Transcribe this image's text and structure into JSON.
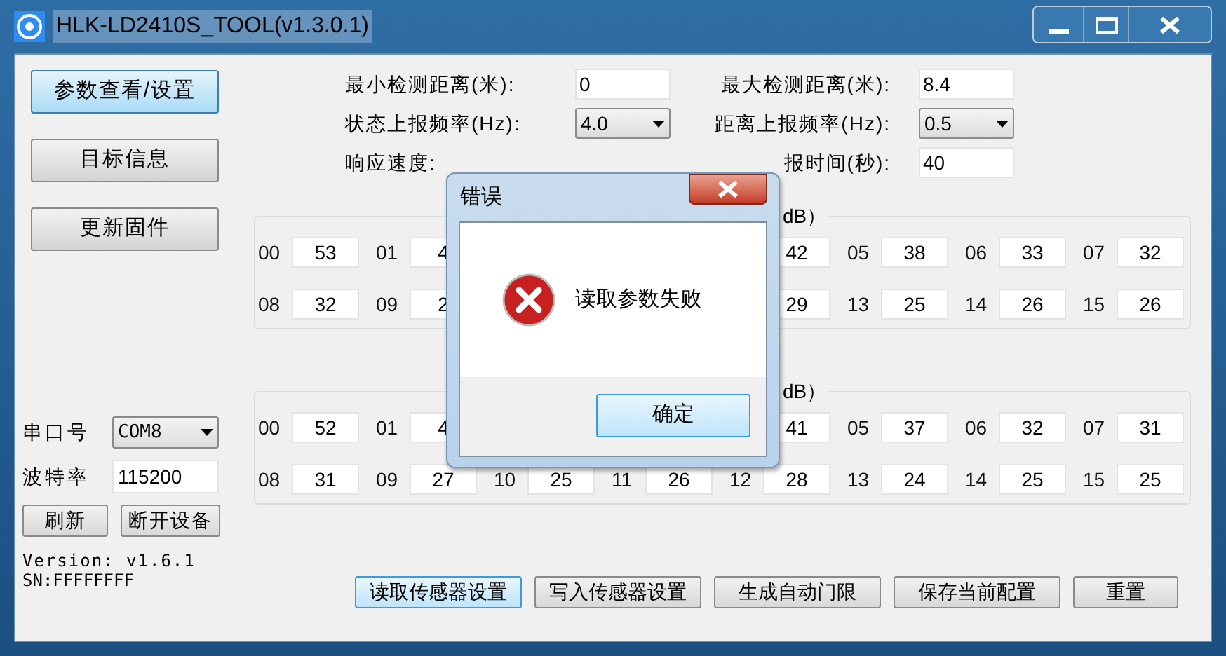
{
  "window": {
    "title": "HLK-LD2410S_TOOL(v1.3.0.1)"
  },
  "nav": [
    {
      "label": "参数查看/设置",
      "selected": true
    },
    {
      "label": "目标信息",
      "selected": false
    },
    {
      "label": "更新固件",
      "selected": false
    }
  ],
  "params_left": [
    {
      "label": "最小检测距离(米):",
      "kind": "field",
      "value": "0"
    },
    {
      "label": "状态上报频率(Hz):",
      "kind": "select",
      "value": "4.0"
    },
    {
      "label": "响应速度:",
      "kind": "none"
    }
  ],
  "params_right": [
    {
      "label": "最大检测距离(米):",
      "kind": "field",
      "value": "8.4"
    },
    {
      "label": "距离上报频率(Hz):",
      "kind": "select",
      "value": "0.5"
    },
    {
      "label": "报时间(秒):",
      "kind": "field",
      "value": "40"
    }
  ],
  "groups": [
    {
      "title": "dB）",
      "rows": [
        {
          "left": [
            {
              "gate": "00",
              "value": "53"
            },
            {
              "gate": "01",
              "value": "4"
            }
          ],
          "right": [
            {
              "value": "42"
            },
            {
              "gate": "05",
              "value": "38"
            },
            {
              "gate": "06",
              "value": "33"
            },
            {
              "gate": "07",
              "value": "32"
            }
          ]
        },
        {
          "left": [
            {
              "gate": "08",
              "value": "32"
            },
            {
              "gate": "09",
              "value": "2"
            }
          ],
          "right": [
            {
              "value": "29"
            },
            {
              "gate": "13",
              "value": "25"
            },
            {
              "gate": "14",
              "value": "26"
            },
            {
              "gate": "15",
              "value": "26"
            }
          ]
        }
      ]
    },
    {
      "title": "dB）",
      "rows": [
        {
          "left": [
            {
              "gate": "00",
              "value": "52"
            },
            {
              "gate": "01",
              "value": "4"
            }
          ],
          "right": [
            {
              "value": "41"
            },
            {
              "gate": "05",
              "value": "37"
            },
            {
              "gate": "06",
              "value": "32"
            },
            {
              "gate": "07",
              "value": "31"
            }
          ]
        },
        {
          "left": [
            {
              "gate": "08",
              "value": "31"
            },
            {
              "gate": "09",
              "value": "27"
            },
            {
              "gate": "10",
              "value": "25"
            },
            {
              "gate": "11",
              "value": "26"
            },
            {
              "gate": "12",
              "value": "28"
            },
            {
              "gate": "13",
              "value": "24"
            },
            {
              "gate": "14",
              "value": "25"
            },
            {
              "gate": "15",
              "value": "25"
            }
          ],
          "right": []
        }
      ]
    }
  ],
  "port": {
    "label": "串口号",
    "value": "COM8"
  },
  "baud": {
    "label": "波特率",
    "value": "115200"
  },
  "port_buttons": [
    "刷新",
    "断开设备"
  ],
  "version": "Version: v1.6.1",
  "sn": "SN:FFFFFFFF",
  "actions": [
    {
      "label": "读取传感器设置",
      "focused": true
    },
    {
      "label": "写入传感器设置",
      "focused": false
    },
    {
      "label": "生成自动门限",
      "focused": false
    },
    {
      "label": "保存当前配置",
      "focused": false
    },
    {
      "label": "重置",
      "focused": false
    }
  ],
  "dialog": {
    "title": "错误",
    "message": "读取参数失败",
    "button": "确定"
  }
}
